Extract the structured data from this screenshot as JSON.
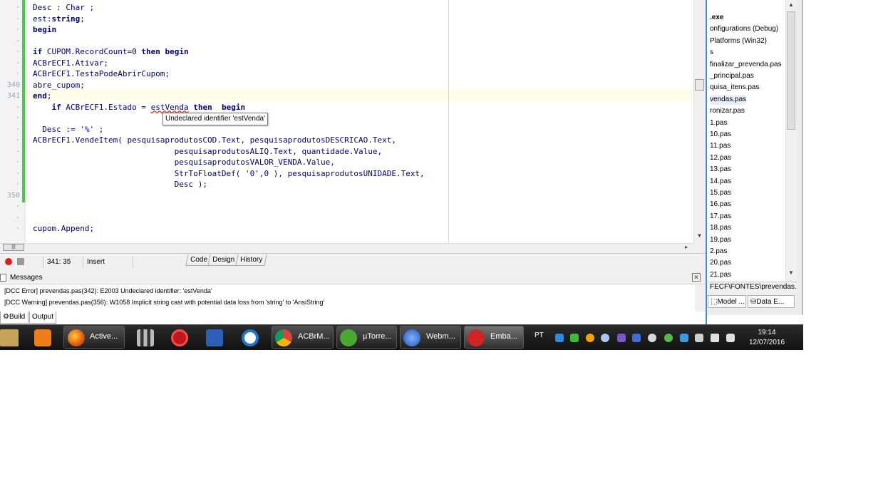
{
  "editor": {
    "lines": [
      {
        "num": "",
        "segs": [
          {
            "t": "Desc : Char ;"
          }
        ]
      },
      {
        "num": "",
        "segs": [
          {
            "t": "est:"
          },
          {
            "t": "string",
            "c": "kw"
          },
          {
            "t": ";"
          }
        ]
      },
      {
        "num": "",
        "segs": [
          {
            "t": "begin",
            "c": "kw"
          }
        ]
      },
      {
        "num": "",
        "segs": []
      },
      {
        "num": "",
        "segs": [
          {
            "t": "if",
            "c": "kw"
          },
          {
            "t": " CUPOM.RecordCount=0 "
          },
          {
            "t": "then",
            "c": "kw"
          },
          {
            "t": " "
          },
          {
            "t": "begin",
            "c": "kw"
          }
        ]
      },
      {
        "num": "",
        "segs": [
          {
            "t": "ACBrECF1.Ativar;"
          }
        ]
      },
      {
        "num": "",
        "segs": [
          {
            "t": "ACBrECF1.TestaPodeAbrirCupom;"
          }
        ]
      },
      {
        "num": "340",
        "segs": [
          {
            "t": "abre_cupom;"
          }
        ]
      },
      {
        "num": "341",
        "segs": [
          {
            "t": "end",
            "c": "kw"
          },
          {
            "t": ";"
          }
        ]
      },
      {
        "num": "",
        "segs": [
          {
            "t": "    "
          },
          {
            "t": "if",
            "c": "kw"
          },
          {
            "t": " ACBrECF1.Estado = "
          },
          {
            "t": "estVenda",
            "c": "err"
          },
          {
            "t": " "
          },
          {
            "t": "then",
            "c": "kw"
          },
          {
            "t": "  "
          },
          {
            "t": "begin",
            "c": "kw"
          }
        ]
      },
      {
        "num": "",
        "segs": []
      },
      {
        "num": "",
        "segs": [
          {
            "t": "  Desc := "
          },
          {
            "t": "'%'",
            "c": "str"
          },
          {
            "t": " ;"
          }
        ]
      },
      {
        "num": "",
        "segs": [
          {
            "t": "ACBrECF1.VendeItem( pesquisaprodutosCOD.Text, pesquisaprodutosDESCRICAO.Text,"
          }
        ]
      },
      {
        "num": "",
        "segs": [
          {
            "t": "                              pesquisaprodutosALIQ.Text, quantidade.Value,"
          }
        ]
      },
      {
        "num": "",
        "segs": [
          {
            "t": "                              pesquisaprodutosVALOR_VENDA.Value,"
          }
        ]
      },
      {
        "num": "",
        "segs": [
          {
            "t": "                              StrToFloatDef( "
          },
          {
            "t": "'0'",
            "c": "str"
          },
          {
            "t": ",0 ), pesquisaprodutosUNIDADE.Text,"
          }
        ]
      },
      {
        "num": "",
        "segs": [
          {
            "t": "                              Desc );"
          }
        ]
      },
      {
        "num": "350",
        "segs": []
      },
      {
        "num": "",
        "segs": []
      },
      {
        "num": "",
        "segs": []
      },
      {
        "num": "",
        "segs": [
          {
            "t": "cupom.Append;"
          }
        ]
      }
    ],
    "tooltip": "Undeclared identifier 'estVenda'"
  },
  "status": {
    "position": "341: 35",
    "mode": "Insert",
    "view_tabs": [
      "Code",
      "Design",
      "History"
    ]
  },
  "messages": {
    "title": "Messages",
    "items": [
      "[DCC Error] prevendas.pas(342): E2003 Undeclared identifier: 'estVenda'",
      "[DCC Warning] prevendas.pas(356): W1058 Implicit string cast with potential data loss from 'string' to 'AnsiString'"
    ],
    "tabs": [
      "Build",
      "Output"
    ]
  },
  "project_tree": {
    "items": [
      ".exe",
      "onfigurations (Debug)",
      "Platforms (Win32)",
      "s",
      "finalizar_prevenda.pas",
      "_principal.pas",
      "quisa_itens.pas",
      "vendas.pas",
      "ronizar.pas",
      "1.pas",
      "10.pas",
      "11.pas",
      "12.pas",
      "13.pas",
      "14.pas",
      "15.pas",
      "16.pas",
      "17.pas",
      "18.pas",
      "19.pas",
      "2.pas",
      "20.pas",
      "21.pas"
    ],
    "selected": "vendas.pas",
    "path": "FECF\\FONTES\\prevendas.p",
    "bottom_tabs": [
      "Model ...",
      "Data E..."
    ]
  },
  "taskbar": {
    "buttons": [
      {
        "label": "Active..."
      },
      {
        "label": "ACBrM..."
      },
      {
        "label": "µTorre..."
      },
      {
        "label": "Webm..."
      },
      {
        "label": "Emba..."
      }
    ],
    "language": "PT",
    "time": "19:14",
    "date": "12/07/2016"
  },
  "colors": {
    "change_bar": "#3dd23d",
    "keyword": "#000080",
    "string": "#0000ff",
    "error_underline": "#ff0000"
  }
}
